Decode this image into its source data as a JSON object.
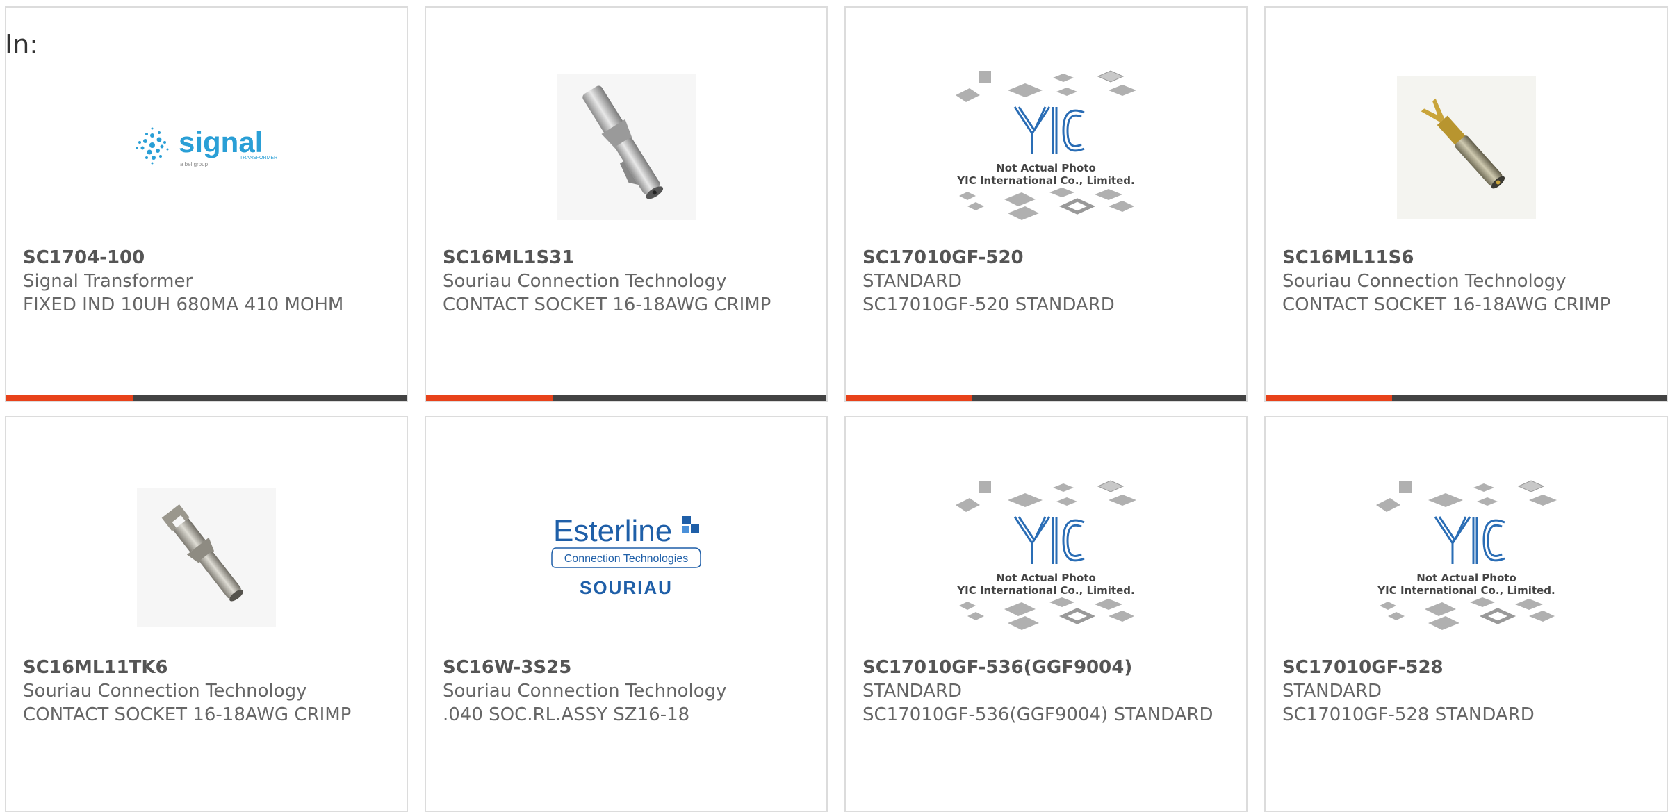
{
  "filter_prefix": "In:",
  "colors": {
    "accent": "#e8421a",
    "bar": "#434343",
    "border": "#dcdcdc",
    "text": "#666666"
  },
  "products": [
    {
      "part_number": "SC1704-100",
      "manufacturer": "Signal Transformer",
      "description": "FIXED IND 10UH 680MA 410 MOHM",
      "image": "signal-transformer-logo",
      "logo": {
        "word": "signal",
        "sub": "TRANSFORMER",
        "tag": "a bel group"
      }
    },
    {
      "part_number": "SC16ML1S31",
      "manufacturer": "Souriau Connection Technology",
      "description": "CONTACT SOCKET 16-18AWG CRIMP",
      "image": "crimp-contact-photo"
    },
    {
      "part_number": "SC17010GF-520",
      "manufacturer": "STANDARD",
      "description": "SC17010GF-520 STANDARD",
      "image": "yic-placeholder",
      "logo": {
        "mark": "YIC",
        "line1": "Not Actual Photo",
        "line2": "YIC International Co., Limited."
      }
    },
    {
      "part_number": "SC16ML11S6",
      "manufacturer": "Souriau Connection Technology",
      "description": "CONTACT SOCKET 16-18AWG CRIMP",
      "image": "gold-contact-photo"
    },
    {
      "part_number": "SC16ML11TK6",
      "manufacturer": "Souriau Connection Technology",
      "description": "CONTACT SOCKET 16-18AWG CRIMP",
      "image": "crimp-contact-photo-2"
    },
    {
      "part_number": "SC16W-3S25",
      "manufacturer": "Souriau Connection Technology",
      "description": ".040 SOC.RL.ASSY SZ16-18",
      "image": "esterline-souriau-logo",
      "logo": {
        "word": "Esterline",
        "sub": "Connection Technologies",
        "tag": "SOURIAU"
      }
    },
    {
      "part_number": "SC17010GF-536(GGF9004)",
      "manufacturer": "STANDARD",
      "description": "SC17010GF-536(GGF9004) STANDARD",
      "image": "yic-placeholder",
      "logo": {
        "mark": "YIC",
        "line1": "Not Actual Photo",
        "line2": "YIC International Co., Limited."
      }
    },
    {
      "part_number": "SC17010GF-528",
      "manufacturer": "STANDARD",
      "description": "SC17010GF-528 STANDARD",
      "image": "yic-placeholder",
      "logo": {
        "mark": "YIC",
        "line1": "Not Actual Photo",
        "line2": "YIC International Co., Limited."
      }
    }
  ]
}
